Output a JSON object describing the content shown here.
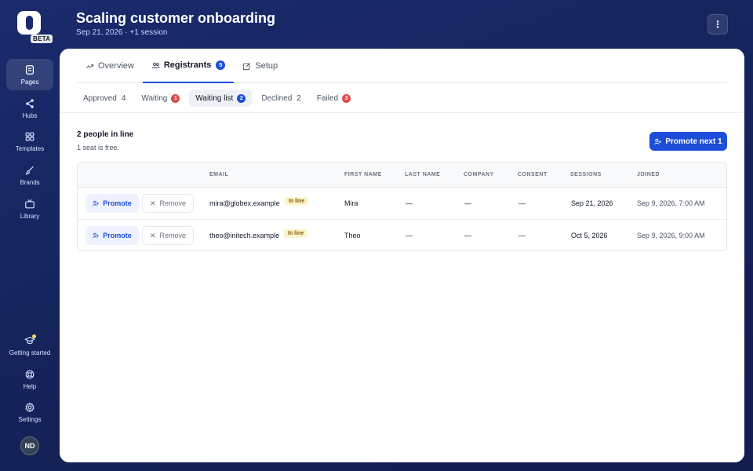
{
  "app": {
    "beta_label": "BETA"
  },
  "header": {
    "title": "Scaling customer onboarding",
    "subtitle": "Sep 21, 2026 · +1 session",
    "more_icon": "kebab-icon"
  },
  "sidebar": {
    "items": [
      {
        "label": "Pages",
        "icon": "pages-icon",
        "active": true
      },
      {
        "label": "Hubs",
        "icon": "share-icon"
      },
      {
        "label": "Templates",
        "icon": "grid-icon"
      },
      {
        "label": "Brands",
        "icon": "brush-icon"
      },
      {
        "label": "Library",
        "icon": "tv-icon"
      }
    ],
    "bottom_items": [
      {
        "label": "Getting started",
        "icon": "graduation-cap-icon",
        "has_dot": true
      },
      {
        "label": "Help",
        "icon": "lifebuoy-icon"
      },
      {
        "label": "Settings",
        "icon": "gear-icon"
      }
    ],
    "avatar_initials": "ND"
  },
  "tabs": [
    {
      "label": "Overview",
      "icon": "trend-icon"
    },
    {
      "label": "Registrants",
      "icon": "users-icon",
      "badge": "5",
      "active": true
    },
    {
      "label": "Setup",
      "icon": "edit-icon"
    }
  ],
  "subtabs": [
    {
      "label": "Approved",
      "count": "4"
    },
    {
      "label": "Waiting",
      "badge": "1",
      "badge_color": "#dc4a4a"
    },
    {
      "label": "Waiting list",
      "badge": "2",
      "badge_color": "#1d4ed8",
      "active": true
    },
    {
      "label": "Declined",
      "count": "2"
    },
    {
      "label": "Failed",
      "badge": "3",
      "badge_color": "#dc4a4a"
    }
  ],
  "summary": {
    "title": "2 people in line",
    "subtitle": "1 seat is free.",
    "promote_next_label": "Promote next 1"
  },
  "table": {
    "columns": [
      "EMAIL",
      "FIRST NAME",
      "LAST NAME",
      "COMPANY",
      "CONSENT",
      "SESSIONS",
      "JOINED"
    ],
    "promote_label": "Promote",
    "remove_label": "Remove",
    "rows": [
      {
        "email": "mira@globex.example",
        "status": "In line",
        "first_name": "Mira",
        "last_name": "—",
        "company": "—",
        "consent": "—",
        "sessions": "Sep 21, 2026",
        "joined": "Sep 9, 2026, 7:00 AM"
      },
      {
        "email": "theo@initech.example",
        "status": "In line",
        "first_name": "Theo",
        "last_name": "—",
        "company": "—",
        "consent": "—",
        "sessions": "Oct 5, 2026",
        "joined": "Sep 9, 2026, 9:00 AM"
      }
    ]
  },
  "colors": {
    "accent": "#1d4ed8",
    "danger": "#dc4a4a",
    "background": "#1a2a6c",
    "inline_badge": "#fef3c7"
  }
}
